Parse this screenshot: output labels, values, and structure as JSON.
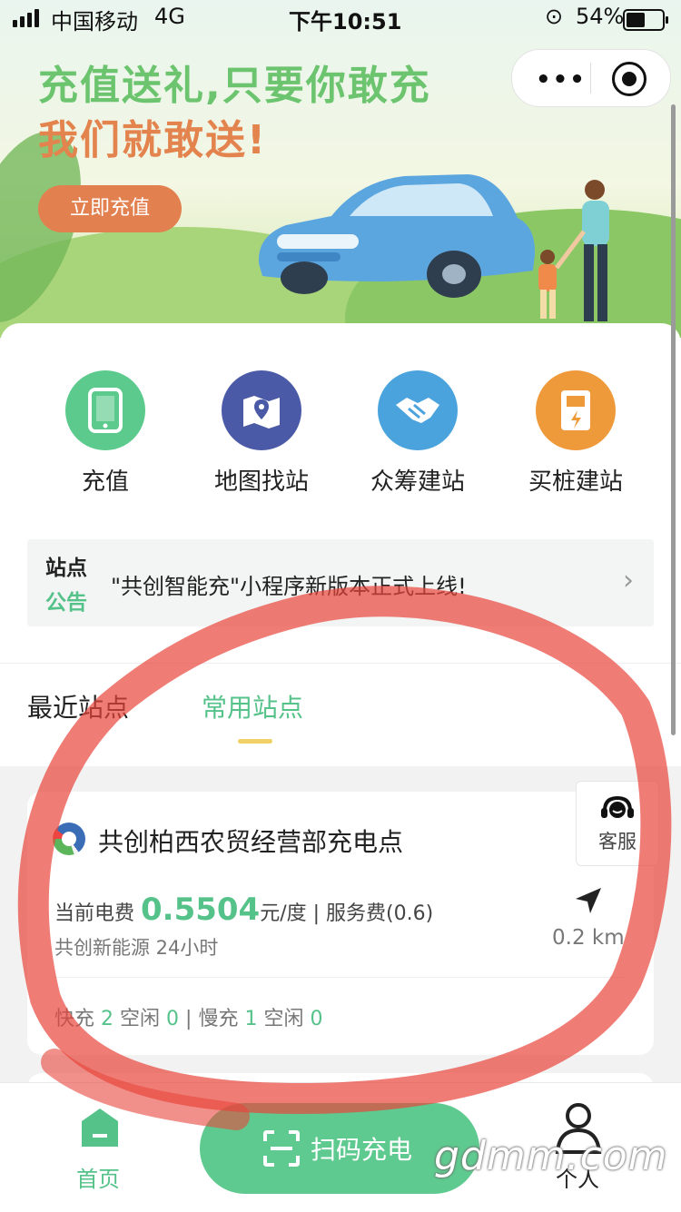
{
  "status_bar": {
    "carrier": "中国移动",
    "network": "4G",
    "time": "下午10:51",
    "battery": "54%"
  },
  "banner": {
    "headline_1": "充值送礼,只要你敢充",
    "headline_2": "我们就敢送!",
    "button_label": "立即充值"
  },
  "quick_actions": [
    {
      "label": "充值",
      "icon": "tablet-icon",
      "color": "#5cc98d"
    },
    {
      "label": "地图找站",
      "icon": "map-pin-icon",
      "color": "#4a5aa6"
    },
    {
      "label": "众筹建站",
      "icon": "handshake-icon",
      "color": "#4aa3dd"
    },
    {
      "label": "买桩建站",
      "icon": "charging-pile-icon",
      "color": "#ee9a3b"
    }
  ],
  "notice": {
    "title_1": "站点",
    "title_2": "公告",
    "text": "\"共创智能充\"小程序新版本正式上线!"
  },
  "tabs": [
    {
      "label": "最近站点",
      "active": false
    },
    {
      "label": "常用站点",
      "active": true
    }
  ],
  "station": {
    "name": "共创柏西农贸经营部充电点",
    "service_label": "客服",
    "price_prefix": "当前电费",
    "price": "0.5504",
    "price_suffix": "元/度 | 服务费(0.6)",
    "operator": "共创新能源 24小时",
    "distance": "0.2 km",
    "fast_label": "快充",
    "fast_total": "2",
    "fast_idle_label": "空闲",
    "fast_idle": "0",
    "separator": "|",
    "slow_label": "慢充",
    "slow_total": "1",
    "slow_idle_label": "空闲",
    "slow_idle": "0"
  },
  "bottom_nav": {
    "home_label": "首页",
    "scan_label": "扫码充电",
    "me_label": "个人"
  },
  "watermark": "gdmm.com",
  "colors": {
    "accent": "#55c28a",
    "marker": "#e8463c"
  }
}
